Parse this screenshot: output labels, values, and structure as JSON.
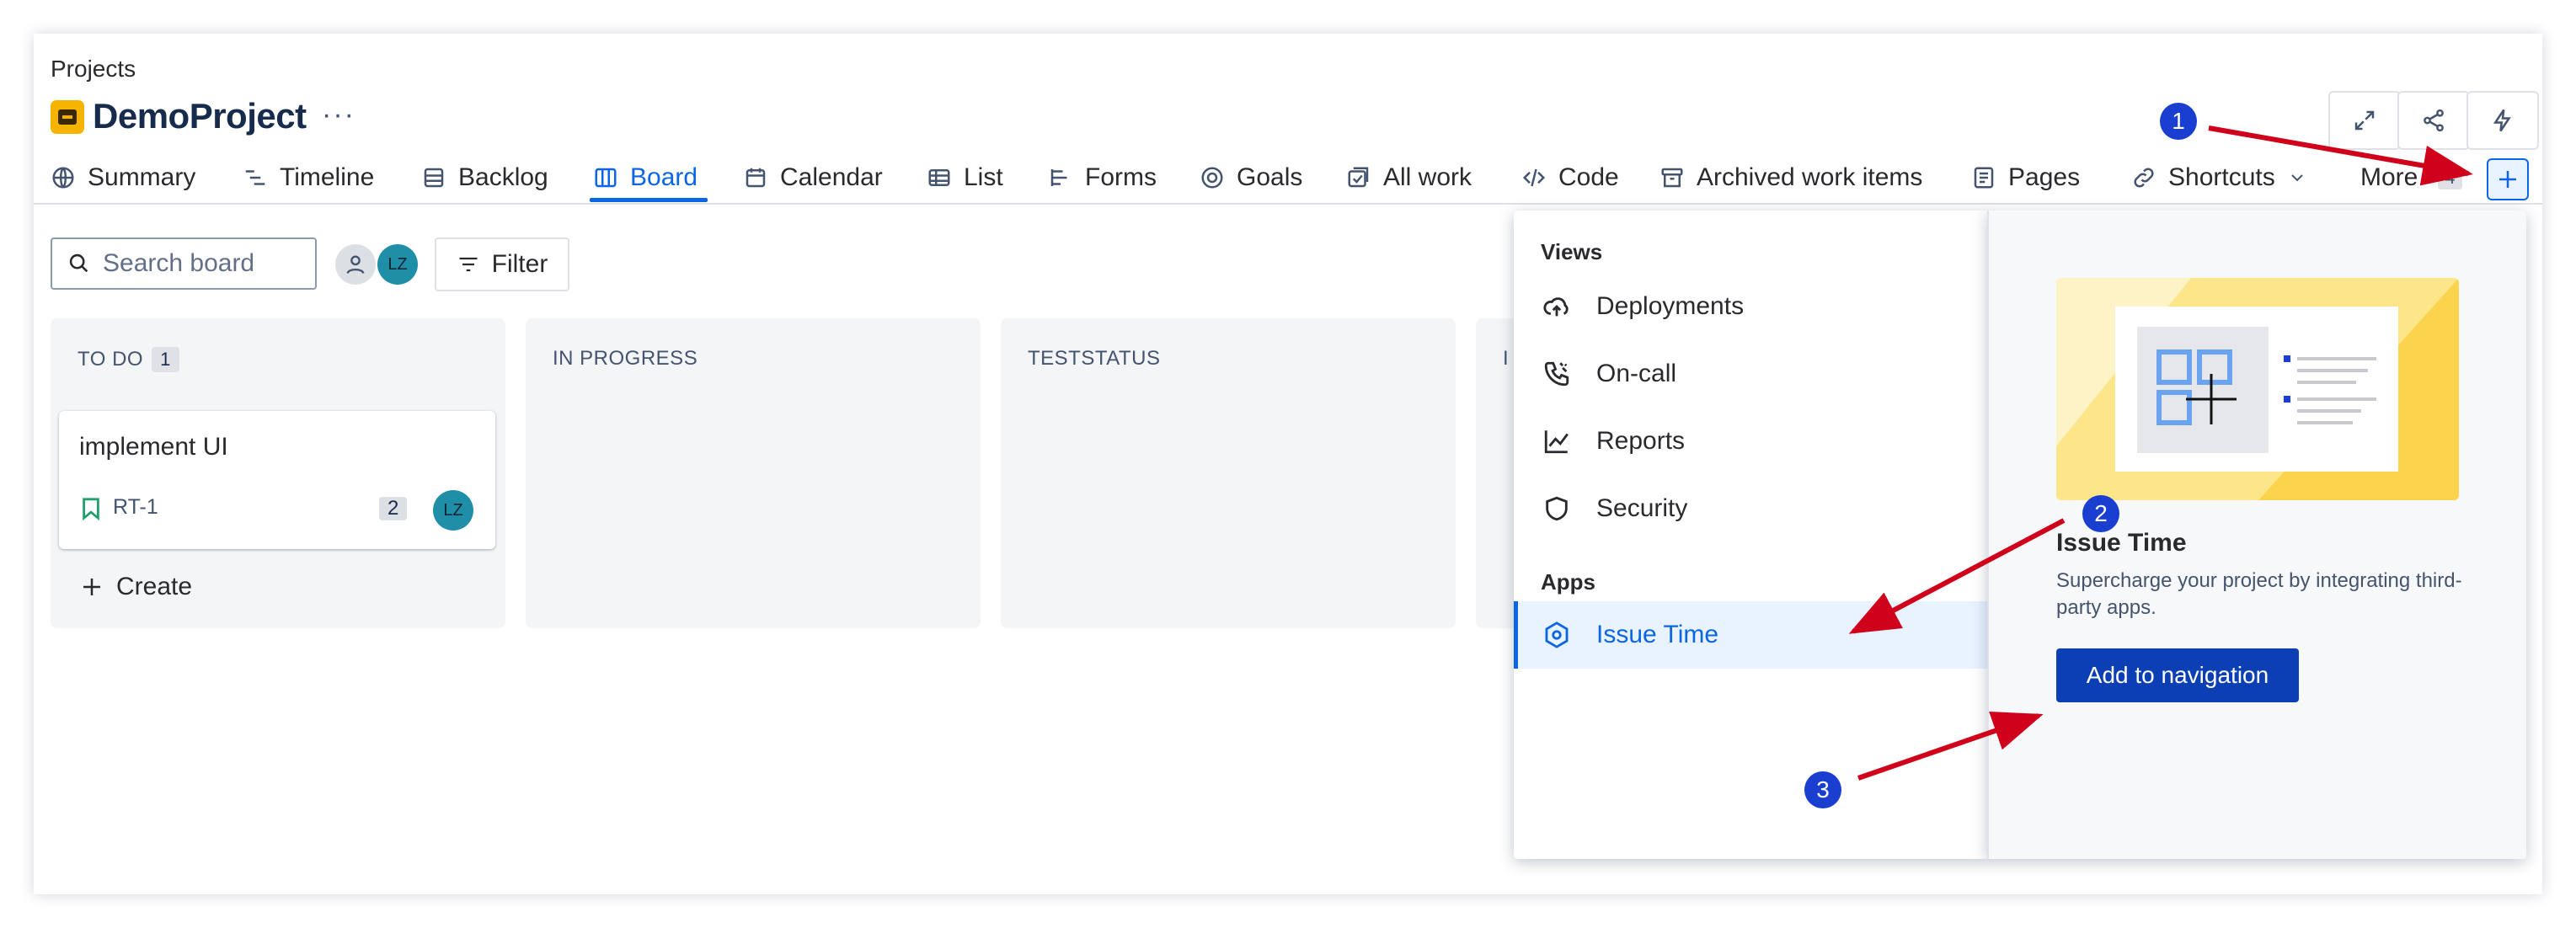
{
  "breadcrumb": "Projects",
  "project": {
    "name": "DemoProject",
    "more": "···"
  },
  "tabs": [
    {
      "label": "Summary",
      "icon": "globe-icon"
    },
    {
      "label": "Timeline",
      "icon": "timeline-icon"
    },
    {
      "label": "Backlog",
      "icon": "backlog-icon"
    },
    {
      "label": "Board",
      "icon": "board-icon",
      "active": true
    },
    {
      "label": "Calendar",
      "icon": "calendar-icon"
    },
    {
      "label": "List",
      "icon": "list-icon"
    },
    {
      "label": "Forms",
      "icon": "forms-icon"
    },
    {
      "label": "Goals",
      "icon": "goals-icon"
    },
    {
      "label": "All work",
      "icon": "all-work-icon"
    },
    {
      "label": "Code",
      "icon": "code-icon"
    },
    {
      "label": "Archived work items",
      "icon": "archive-icon"
    },
    {
      "label": "Pages",
      "icon": "pages-icon"
    },
    {
      "label": "Shortcuts",
      "icon": "link-icon"
    },
    {
      "label": "More",
      "icon": ""
    }
  ],
  "more_count": "4",
  "toolbar": {
    "search_placeholder": "Search board",
    "filter_label": "Filter",
    "avatar_initials": "LZ"
  },
  "columns": [
    {
      "title": "TO DO",
      "count": "1"
    },
    {
      "title": "IN PROGRESS"
    },
    {
      "title": "TESTSTATUS"
    },
    {
      "title": "I"
    }
  ],
  "issue": {
    "title": "implement UI",
    "key": "RT-1",
    "estimate": "2",
    "assignee": "LZ"
  },
  "create_label": "Create",
  "dropdown": {
    "views_heading": "Views",
    "views": [
      {
        "label": "Deployments",
        "icon": "cloud-upload-icon"
      },
      {
        "label": "On-call",
        "icon": "phone-icon"
      },
      {
        "label": "Reports",
        "icon": "chart-icon"
      },
      {
        "label": "Security",
        "icon": "shield-icon"
      }
    ],
    "apps_heading": "Apps",
    "apps": [
      {
        "label": "Issue Time",
        "icon": "hexagon-icon"
      }
    ],
    "promo": {
      "title": "Issue Time",
      "description": "Supercharge your project by integrating third-party apps.",
      "button": "Add to navigation"
    }
  },
  "annotations": [
    "1",
    "2",
    "3"
  ],
  "colors": {
    "accent": "#0c66e4",
    "annotation_red": "#d0021b",
    "step_blue": "#1a3fd0",
    "button_dark": "#0c3fb3"
  }
}
